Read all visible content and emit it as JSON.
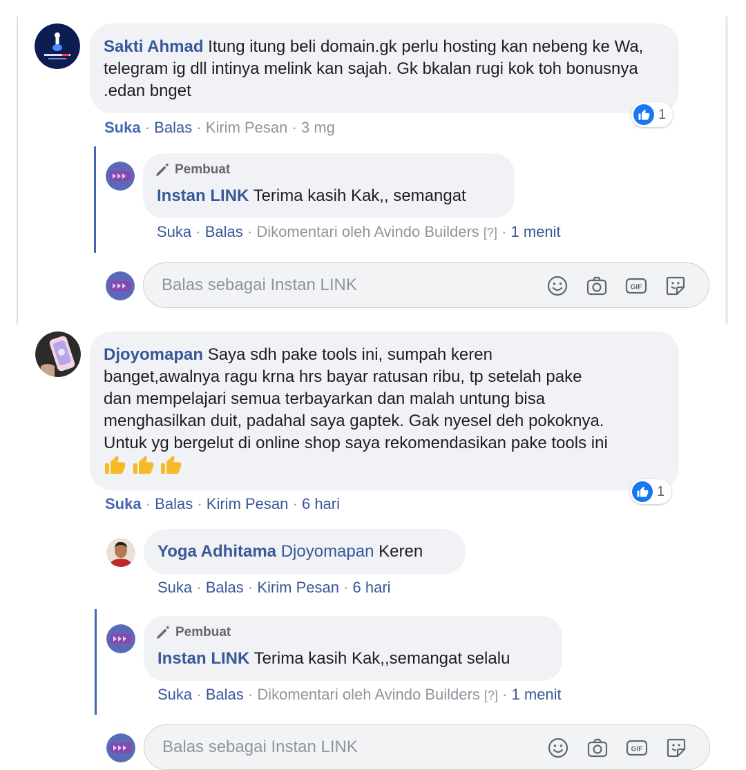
{
  "comments": [
    {
      "author": "Sakti Ahmad",
      "text": "Itung itung beli domain.gk perlu hosting kan nebeng ke Wa, telegram ig dll intinya melink kan sajah. Gk bkalan rugi kok toh bonusnya .edan bnget",
      "reaction_count": "1",
      "actions": {
        "like": "Suka",
        "reply": "Balas",
        "message": "Kirim Pesan",
        "time": "3 mg"
      },
      "replies": [
        {
          "badge": "Pembuat",
          "author": "Instan LINK",
          "text": "Terima kasih Kak,, semangat",
          "actions": {
            "like": "Suka",
            "reply": "Balas",
            "commented_by": "Dikomentari oleh Avindo Builders",
            "help": "[?]",
            "time": "1 menit"
          }
        }
      ],
      "reply_box": {
        "placeholder": "Balas sebagai Instan LINK"
      }
    },
    {
      "author": "Djoyomapan",
      "text_lines": [
        "Saya sdh pake tools ini, sumpah keren",
        "banget,awalnya ragu krna hrs bayar ratusan ribu, tp setelah pake",
        "dan mempelajari semua terbayarkan dan malah untung bisa",
        "menghasilkan duit, padahal saya gaptek. Gak nyesel deh pokoknya.",
        "Untuk yg bergelut di online shop saya rekomendasikan pake tools ini"
      ],
      "emojis": [
        "thumbs-up",
        "thumbs-up",
        "thumbs-up"
      ],
      "reaction_count": "1",
      "actions": {
        "like": "Suka",
        "reply": "Balas",
        "message": "Kirim Pesan",
        "time": "6 hari"
      },
      "replies": [
        {
          "author": "Yoga Adhitama",
          "mention": "Djoyomapan",
          "text": "Keren",
          "actions": {
            "like": "Suka",
            "reply": "Balas",
            "message": "Kirim Pesan",
            "time": "6 hari"
          }
        },
        {
          "badge": "Pembuat",
          "author": "Instan LINK",
          "text": "Terima kasih Kak,,semangat selalu",
          "actions": {
            "like": "Suka",
            "reply": "Balas",
            "commented_by": "Dikomentari oleh Avindo Builders",
            "help": "[?]",
            "time": "1 menit"
          }
        }
      ],
      "reply_box": {
        "placeholder": "Balas sebagai Instan LINK"
      }
    }
  ],
  "icons": {
    "reply_tools": [
      "smiley-icon",
      "camera-icon",
      "gif-icon",
      "sticker-icon"
    ],
    "reaction": "like-reaction-icon",
    "badge": "pen-icon"
  },
  "colors": {
    "accent": "#4267b2",
    "author": "#385898",
    "bubble": "#f0f2f5",
    "like": "#1877f2"
  }
}
